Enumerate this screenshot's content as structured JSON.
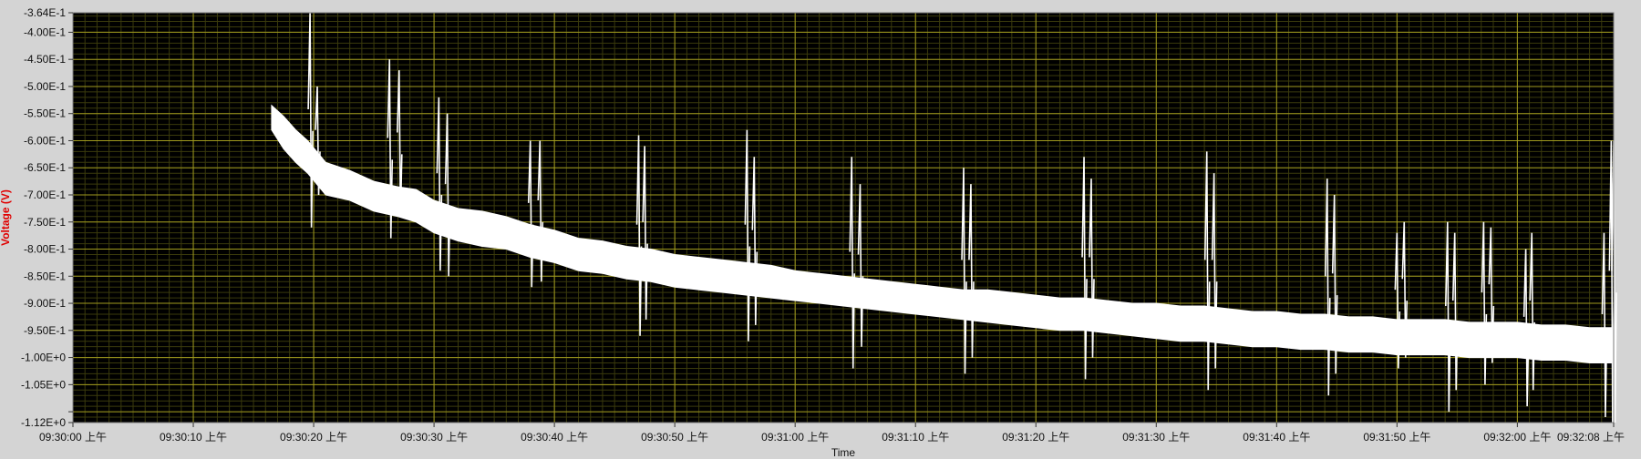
{
  "chart_data": {
    "type": "line",
    "title": "",
    "xlabel": "Time",
    "ylabel": "Voltage (V)",
    "x_domain_seconds": [
      0,
      128
    ],
    "ylim": [
      -1.12,
      -0.364
    ],
    "y_ticks": [
      {
        "value": -0.364,
        "label": "-3.64E-1"
      },
      {
        "value": -0.4,
        "label": "-4.00E-1"
      },
      {
        "value": -0.45,
        "label": "-4.50E-1"
      },
      {
        "value": -0.5,
        "label": "-5.00E-1"
      },
      {
        "value": -0.55,
        "label": "-5.50E-1"
      },
      {
        "value": -0.6,
        "label": "-6.00E-1"
      },
      {
        "value": -0.65,
        "label": "-6.50E-1"
      },
      {
        "value": -0.7,
        "label": "-7.00E-1"
      },
      {
        "value": -0.75,
        "label": "-7.50E-1"
      },
      {
        "value": -0.8,
        "label": "-8.00E-1"
      },
      {
        "value": -0.85,
        "label": "-8.50E-1"
      },
      {
        "value": -0.9,
        "label": "-9.00E-1"
      },
      {
        "value": -0.95,
        "label": "-9.50E-1"
      },
      {
        "value": -1.0,
        "label": "-1.00E+0"
      },
      {
        "value": -1.05,
        "label": "-1.05E+0"
      },
      {
        "value": -1.1,
        "label": ""
      },
      {
        "value": -1.12,
        "label": "-1.12E+0"
      }
    ],
    "x_ticks": [
      {
        "value": 0,
        "label": "09:30:00 上午"
      },
      {
        "value": 10,
        "label": "09:30:10 上午"
      },
      {
        "value": 20,
        "label": "09:30:20 上午"
      },
      {
        "value": 30,
        "label": "09:30:30 上午"
      },
      {
        "value": 40,
        "label": "09:30:40 上午"
      },
      {
        "value": 50,
        "label": "09:30:50 上午"
      },
      {
        "value": 60,
        "label": "09:31:00 上午"
      },
      {
        "value": 70,
        "label": "09:31:10 上午"
      },
      {
        "value": 80,
        "label": "09:31:20 上午"
      },
      {
        "value": 90,
        "label": "09:31:30 上午"
      },
      {
        "value": 100,
        "label": "09:31:40 上午"
      },
      {
        "value": 110,
        "label": "09:31:50 上午"
      },
      {
        "value": 120,
        "label": "09:32:00 上午"
      },
      {
        "value": 128,
        "label": "09:32:08 上午"
      }
    ],
    "grid": true,
    "colors": {
      "plot_background": "#000000",
      "major_grid": "#a09a1e",
      "minor_grid": "#3a3a0c",
      "trace": "#ffffff",
      "axis_label": "#e00000",
      "frame": "#d4d4d4"
    },
    "series": [
      {
        "band": [
          {
            "x": 16.5,
            "top": -0.535,
            "bot": -0.58
          },
          {
            "x": 17.5,
            "top": -0.555,
            "bot": -0.615
          },
          {
            "x": 18.5,
            "top": -0.58,
            "bot": -0.64
          },
          {
            "x": 19.5,
            "top": -0.6,
            "bot": -0.66
          },
          {
            "x": 21.0,
            "top": -0.64,
            "bot": -0.7
          },
          {
            "x": 23.0,
            "top": -0.655,
            "bot": -0.71
          },
          {
            "x": 25.0,
            "top": -0.675,
            "bot": -0.73
          },
          {
            "x": 27.0,
            "top": -0.685,
            "bot": -0.74
          },
          {
            "x": 28.5,
            "top": -0.69,
            "bot": -0.75
          },
          {
            "x": 30.0,
            "top": -0.71,
            "bot": -0.77
          },
          {
            "x": 32.0,
            "top": -0.725,
            "bot": -0.785
          },
          {
            "x": 34.0,
            "top": -0.73,
            "bot": -0.795
          },
          {
            "x": 36.0,
            "top": -0.74,
            "bot": -0.8
          },
          {
            "x": 38.0,
            "top": -0.755,
            "bot": -0.815
          },
          {
            "x": 40.0,
            "top": -0.765,
            "bot": -0.825
          },
          {
            "x": 42.0,
            "top": -0.78,
            "bot": -0.84
          },
          {
            "x": 44.0,
            "top": -0.785,
            "bot": -0.845
          },
          {
            "x": 46.0,
            "top": -0.795,
            "bot": -0.855
          },
          {
            "x": 48.0,
            "top": -0.8,
            "bot": -0.86
          },
          {
            "x": 50.0,
            "top": -0.81,
            "bot": -0.87
          },
          {
            "x": 52.0,
            "top": -0.815,
            "bot": -0.875
          },
          {
            "x": 54.0,
            "top": -0.82,
            "bot": -0.88
          },
          {
            "x": 56.0,
            "top": -0.825,
            "bot": -0.885
          },
          {
            "x": 58.0,
            "top": -0.83,
            "bot": -0.89
          },
          {
            "x": 60.0,
            "top": -0.84,
            "bot": -0.895
          },
          {
            "x": 62.0,
            "top": -0.845,
            "bot": -0.9
          },
          {
            "x": 64.0,
            "top": -0.85,
            "bot": -0.905
          },
          {
            "x": 66.0,
            "top": -0.855,
            "bot": -0.91
          },
          {
            "x": 68.0,
            "top": -0.86,
            "bot": -0.915
          },
          {
            "x": 70.0,
            "top": -0.865,
            "bot": -0.92
          },
          {
            "x": 72.0,
            "top": -0.87,
            "bot": -0.925
          },
          {
            "x": 74.0,
            "top": -0.875,
            "bot": -0.93
          },
          {
            "x": 76.0,
            "top": -0.875,
            "bot": -0.935
          },
          {
            "x": 78.0,
            "top": -0.88,
            "bot": -0.94
          },
          {
            "x": 80.0,
            "top": -0.885,
            "bot": -0.945
          },
          {
            "x": 82.0,
            "top": -0.89,
            "bot": -0.95
          },
          {
            "x": 84.0,
            "top": -0.89,
            "bot": -0.95
          },
          {
            "x": 86.0,
            "top": -0.895,
            "bot": -0.955
          },
          {
            "x": 88.0,
            "top": -0.9,
            "bot": -0.96
          },
          {
            "x": 90.0,
            "top": -0.9,
            "bot": -0.965
          },
          {
            "x": 92.0,
            "top": -0.905,
            "bot": -0.97
          },
          {
            "x": 94.0,
            "top": -0.905,
            "bot": -0.97
          },
          {
            "x": 96.0,
            "top": -0.91,
            "bot": -0.975
          },
          {
            "x": 98.0,
            "top": -0.915,
            "bot": -0.98
          },
          {
            "x": 100.0,
            "top": -0.915,
            "bot": -0.98
          },
          {
            "x": 102.0,
            "top": -0.92,
            "bot": -0.985
          },
          {
            "x": 104.0,
            "top": -0.92,
            "bot": -0.985
          },
          {
            "x": 106.0,
            "top": -0.925,
            "bot": -0.99
          },
          {
            "x": 108.0,
            "top": -0.925,
            "bot": -0.99
          },
          {
            "x": 110.0,
            "top": -0.93,
            "bot": -0.995
          },
          {
            "x": 112.0,
            "top": -0.93,
            "bot": -0.995
          },
          {
            "x": 114.0,
            "top": -0.93,
            "bot": -0.995
          },
          {
            "x": 116.0,
            "top": -0.935,
            "bot": -1.0
          },
          {
            "x": 118.0,
            "top": -0.935,
            "bot": -1.0
          },
          {
            "x": 120.0,
            "top": -0.935,
            "bot": -1.0
          },
          {
            "x": 122.0,
            "top": -0.94,
            "bot": -1.005
          },
          {
            "x": 124.0,
            "top": -0.94,
            "bot": -1.005
          },
          {
            "x": 126.0,
            "top": -0.945,
            "bot": -1.01
          },
          {
            "x": 128.0,
            "top": -0.945,
            "bot": -1.01
          }
        ],
        "spikes": [
          {
            "x": 19.7,
            "hi": -0.364,
            "lo": -0.76
          },
          {
            "x": 20.3,
            "hi": -0.5,
            "lo": -0.7
          },
          {
            "x": 26.3,
            "hi": -0.45,
            "lo": -0.78
          },
          {
            "x": 27.1,
            "hi": -0.47,
            "lo": -0.74
          },
          {
            "x": 30.4,
            "hi": -0.52,
            "lo": -0.84
          },
          {
            "x": 31.1,
            "hi": -0.55,
            "lo": -0.85
          },
          {
            "x": 38.0,
            "hi": -0.6,
            "lo": -0.87
          },
          {
            "x": 38.8,
            "hi": -0.6,
            "lo": -0.86
          },
          {
            "x": 47.0,
            "hi": -0.59,
            "lo": -0.96
          },
          {
            "x": 47.5,
            "hi": -0.61,
            "lo": -0.93
          },
          {
            "x": 56.0,
            "hi": -0.58,
            "lo": -0.97
          },
          {
            "x": 56.6,
            "hi": -0.63,
            "lo": -0.94
          },
          {
            "x": 64.7,
            "hi": -0.63,
            "lo": -1.02
          },
          {
            "x": 65.4,
            "hi": -0.68,
            "lo": -0.98
          },
          {
            "x": 74.0,
            "hi": -0.65,
            "lo": -1.03
          },
          {
            "x": 74.6,
            "hi": -0.68,
            "lo": -1.0
          },
          {
            "x": 84.0,
            "hi": -0.63,
            "lo": -1.04
          },
          {
            "x": 84.6,
            "hi": -0.67,
            "lo": -1.0
          },
          {
            "x": 94.2,
            "hi": -0.62,
            "lo": -1.06
          },
          {
            "x": 94.8,
            "hi": -0.66,
            "lo": -1.02
          },
          {
            "x": 104.2,
            "hi": -0.67,
            "lo": -1.07
          },
          {
            "x": 104.8,
            "hi": -0.7,
            "lo": -1.03
          },
          {
            "x": 110.0,
            "hi": -0.77,
            "lo": -1.02
          },
          {
            "x": 110.6,
            "hi": -0.75,
            "lo": -1.0
          },
          {
            "x": 114.2,
            "hi": -0.75,
            "lo": -1.1
          },
          {
            "x": 114.8,
            "hi": -0.77,
            "lo": -1.06
          },
          {
            "x": 117.2,
            "hi": -0.75,
            "lo": -1.05
          },
          {
            "x": 117.8,
            "hi": -0.76,
            "lo": -1.01
          },
          {
            "x": 120.7,
            "hi": -0.8,
            "lo": -1.09
          },
          {
            "x": 121.2,
            "hi": -0.77,
            "lo": -1.06
          },
          {
            "x": 127.2,
            "hi": -0.77,
            "lo": -1.11
          },
          {
            "x": 127.8,
            "hi": -0.6,
            "lo": -1.12
          },
          {
            "x": 128.0,
            "hi": -0.6,
            "lo": -1.12
          }
        ]
      }
    ]
  }
}
